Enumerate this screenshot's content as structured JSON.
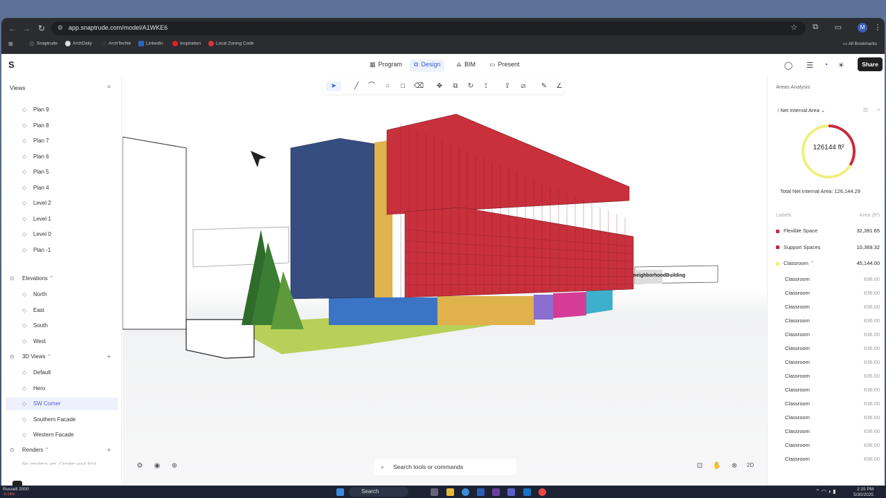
{
  "browser": {
    "url": "app.snaptrude.com/model/A1WKE6",
    "bookmarks": [
      "Snaptrude",
      "ArchDaily",
      "ArchTechie",
      "LinkedIn",
      "Inspiration",
      "Local Zoning Code"
    ],
    "all_bookmarks": "All Bookmarks",
    "avatar": "M"
  },
  "topbar": {
    "modes": [
      "Program",
      "Design",
      "BIM",
      "Present"
    ],
    "active": "Design",
    "share": "Share"
  },
  "left": {
    "title": "Views",
    "plans": [
      "Plan 9",
      "Plan 8",
      "Plan 7",
      "Plan 6",
      "Plan 5",
      "Plan 4",
      "Level 2",
      "Level 1",
      "Level 0",
      "Plan -1"
    ],
    "elevations_label": "Elevations",
    "elevations": [
      "North",
      "East",
      "South",
      "West"
    ],
    "views3d_label": "3D Views",
    "views3d": [
      "Default",
      "Hero",
      "SW Corner",
      "Southern Facade",
      "Western Facade"
    ],
    "selected": "SW Corner",
    "renders_label": "Renders",
    "renders_note": "No renders yet. Create your first"
  },
  "viewport": {
    "neighbor_label": "neighborhoodBuilding",
    "search_placeholder": "Search tools or commands",
    "mode2d": "2D"
  },
  "right": {
    "title": "Areas Analysis",
    "metric": "Net Internal Area",
    "total_area": "126144 ft²",
    "total_label": "Total Net Internal Area: 126,144.29",
    "labels_col": "Labels",
    "area_col": "Area (ft²)",
    "labels": [
      {
        "name": "Flexible Space",
        "value": "32,391.65",
        "color": "#c62b43"
      },
      {
        "name": "Support Spaces",
        "value": "10,369.32",
        "color": "#c62b43"
      },
      {
        "name": "Classroom",
        "value": "45,144.00",
        "color": "#f2ef7a"
      }
    ],
    "sublabel": "Classroom",
    "subvalue": "836.00",
    "subcount": 14
  },
  "taskbar": {
    "ticker": "Russell 2000",
    "ticker_val": "-0.18%",
    "search": "Search",
    "time": "2:15 PM",
    "date": "5/30/2025"
  }
}
